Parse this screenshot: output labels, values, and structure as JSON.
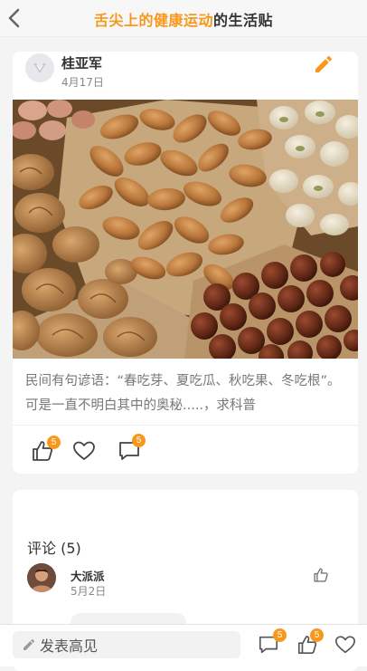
{
  "header": {
    "title_highlight": "舌尖上的健康运动",
    "title_rest": "的生活贴",
    "back_icon": "chevron-left-icon"
  },
  "post": {
    "author": "桂亚军",
    "date": "4月17日",
    "edit_icon": "pencil-icon",
    "image_alt": "坚果",
    "text_line1": "民间有句谚语：“春吃芽、夏吃瓜、秋吃果、冬吃根”。",
    "text_line2": "可是一直不明白其中的奥秘.....，求科普",
    "actions": {
      "like_count": "5",
      "comment_count": "5"
    }
  },
  "comments": {
    "header": "评论 (5)",
    "items": [
      {
        "name": "大派派",
        "date": "5月2日"
      }
    ]
  },
  "bottom_bar": {
    "input_placeholder": "发表高见",
    "comment_count": "5",
    "like_count": "5"
  },
  "colors": {
    "accent": "#f7981c",
    "text_dark": "#333333",
    "text_muted": "#777777",
    "background": "#f4f4f4"
  }
}
